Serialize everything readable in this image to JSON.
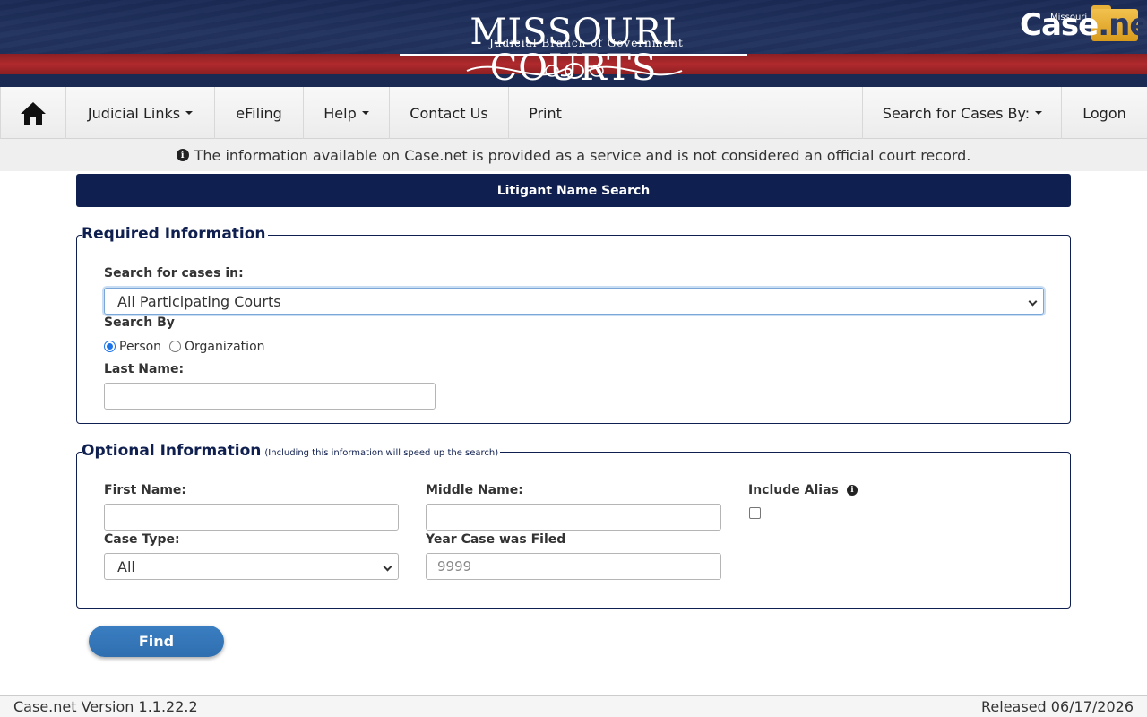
{
  "header": {
    "logo_title": "MISSOURI COURTS",
    "logo_subtitle": "Judicial Branch of Government",
    "casenet_logo_state": "Missouri",
    "casenet_logo_text_a": "Case",
    "casenet_logo_text_b": ".net"
  },
  "nav": {
    "home_icon": "home-icon",
    "judicial_links": "Judicial Links",
    "efiling": "eFiling",
    "help": "Help",
    "contact_us": "Contact Us",
    "print": "Print",
    "search_for_cases_by": "Search for Cases By:",
    "logon": "Logon"
  },
  "notice": {
    "icon": "info-icon",
    "text": "The information available on Case.net is provided as a service and is not considered an official court record."
  },
  "page_title": "Litigant Name Search",
  "required": {
    "legend": "Required Information",
    "search_cases_in_label": "Search for cases in:",
    "search_cases_in_value": "All Participating Courts",
    "search_by_label": "Search By",
    "person_label": "Person",
    "organization_label": "Organization",
    "search_by_selected": "Person",
    "last_name_label": "Last Name:",
    "last_name_value": ""
  },
  "optional": {
    "legend": "Optional Information",
    "legend_note": "(Including this information will speed up the search)",
    "first_name_label": "First Name:",
    "first_name_value": "",
    "middle_name_label": "Middle Name:",
    "middle_name_value": "",
    "include_alias_label": "Include Alias",
    "include_alias_checked": false,
    "case_type_label": "Case Type:",
    "case_type_value": "All",
    "year_label": "Year Case was Filed",
    "year_placeholder": "9999"
  },
  "find_button": "Find",
  "footer": {
    "version": "Case.net Version 1.1.22.2",
    "released": "Released 06/17/2026"
  }
}
